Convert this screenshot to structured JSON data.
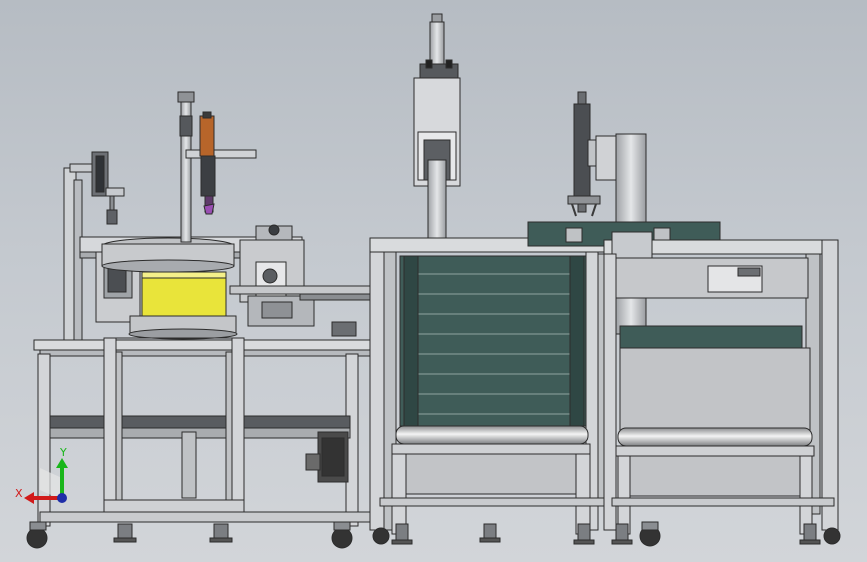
{
  "viewport": {
    "background_top": "#b6bcc3",
    "background_bottom": "#d2d5d9"
  },
  "triad": {
    "x_label": "X",
    "y_label": "Y",
    "x_color": "#d11a1a",
    "y_color": "#19b61a",
    "z_color": "#1f2ea8"
  },
  "model": {
    "frame_color": "#d4d6d8",
    "panel_color": "#3f5c58",
    "bowl_color": "#e9e43a",
    "motor_color": "#4a4a4a"
  }
}
